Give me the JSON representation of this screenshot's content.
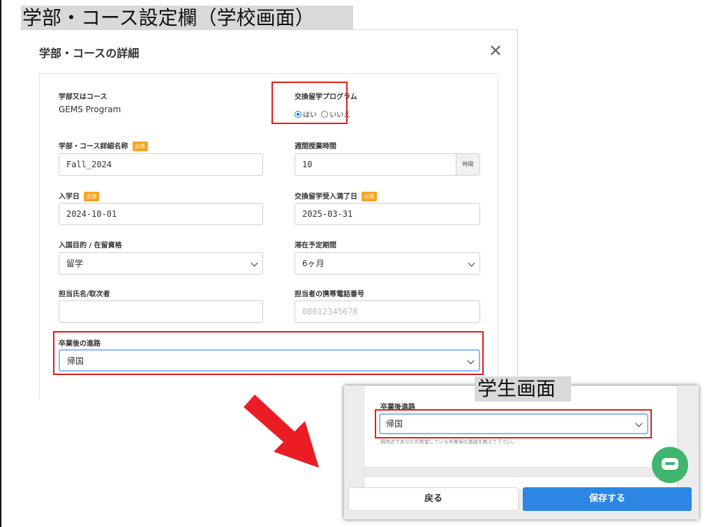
{
  "captions": {
    "school_screen": "学部・コース設定欄（学校画面）",
    "student_screen": "学生画面"
  },
  "modal": {
    "title": "学部・コースの詳細",
    "close_icon": "close-icon",
    "required_badge": "必須",
    "fields": {
      "department_label": "学部又はコース",
      "department_value": "GEMS Program",
      "exchange_label": "交換留学プログラム",
      "exchange_yes": "はい",
      "exchange_no": "いいえ",
      "exchange_selected": "はい",
      "detail_name_label": "学部・コース詳細名称",
      "detail_name_value": "Fall_2024",
      "weekly_hours_label": "週間授業時間",
      "weekly_hours_value": "10",
      "weekly_hours_unit": "時間",
      "admission_date_label": "入学日",
      "admission_date_value": "2024-10-01",
      "exchange_end_label": "交換留学受入満了日",
      "exchange_end_value": "2025-03-31",
      "purpose_label": "入国目的 / 在留資格",
      "purpose_value": "留学",
      "stay_period_label": "滞在予定期間",
      "stay_period_value": "6ヶ月",
      "contact_name_label": "担当氏名/取次者",
      "contact_name_value": "",
      "contact_phone_label": "担当者の携帯電話番号",
      "contact_phone_placeholder": "08012345678",
      "career_label": "卒業後の進路",
      "career_value": "帰国"
    }
  },
  "student": {
    "career_label": "卒業後進路",
    "career_value": "帰国",
    "help_text": "現時点であなたが希望している卒業後の進路を教えて下さい。",
    "back_button": "戻る",
    "save_button": "保存する",
    "chat_icon": "chat-icon",
    "save_color": "#2b86e6",
    "chat_color": "#3fb56d"
  },
  "highlight_color": "#e21c1c",
  "arrow_color": "#ec1c24"
}
